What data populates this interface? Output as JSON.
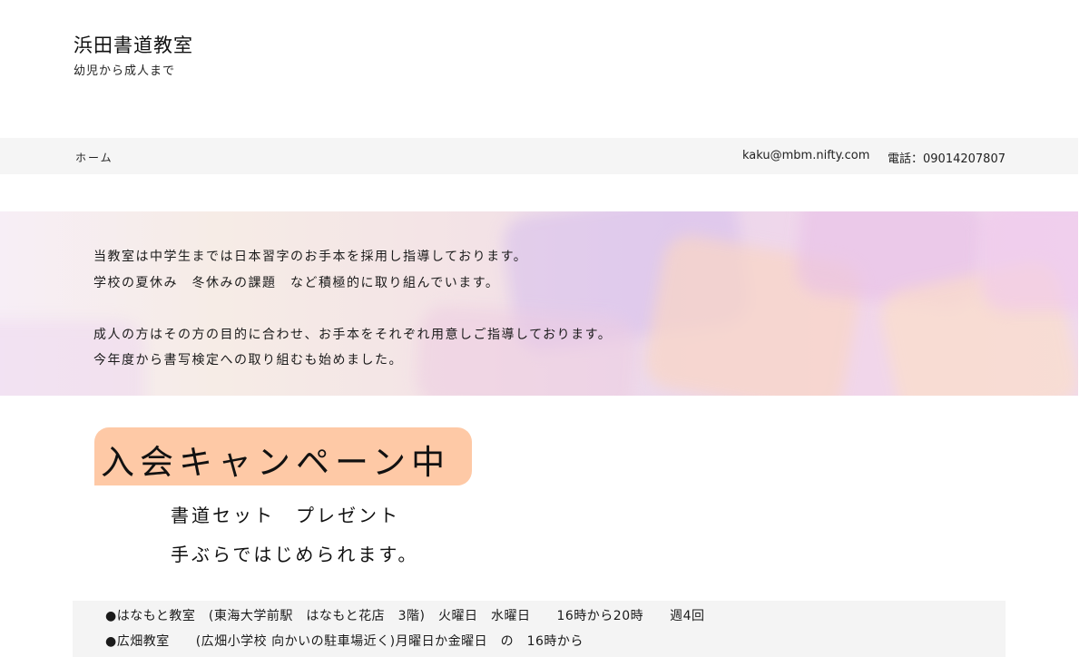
{
  "header": {
    "title": "浜田書道教室",
    "subtitle": "幼児から成人まで"
  },
  "nav": {
    "home": "ホーム",
    "email": "kaku@mbm.nifty.com",
    "phone": "電話：09014207807"
  },
  "hero": {
    "lines": [
      "当教室は中学生までは日本習字のお手本を採用し指導しております。",
      "学校の夏休み　冬休みの課題　など積極的に取り組んでいます。",
      "",
      "成人の方はその方の目的に合わせ、お手本をそれぞれ用意しご指導しております。",
      "今年度から書写検定への取り組むも始めました。"
    ]
  },
  "campaign": {
    "title": "入会キャンペーン中",
    "line1": "書道セット　プレゼント",
    "line2": "手ぶらではじめられます。"
  },
  "classes": {
    "items": [
      "●はなもと教室　(東海大学前駅　はなもと花店　3階)　火曜日　水曜日　　16時から20時　　週4回",
      "●広畑教室　　(広畑小学校 向かいの駐車場近く)月曜日か金曜日　の　16時から"
    ]
  },
  "colors": {
    "navbar_bg": "#f5f5f5",
    "campaign_bg": "#fec9a6",
    "classes_bg": "#f4f4f4"
  }
}
